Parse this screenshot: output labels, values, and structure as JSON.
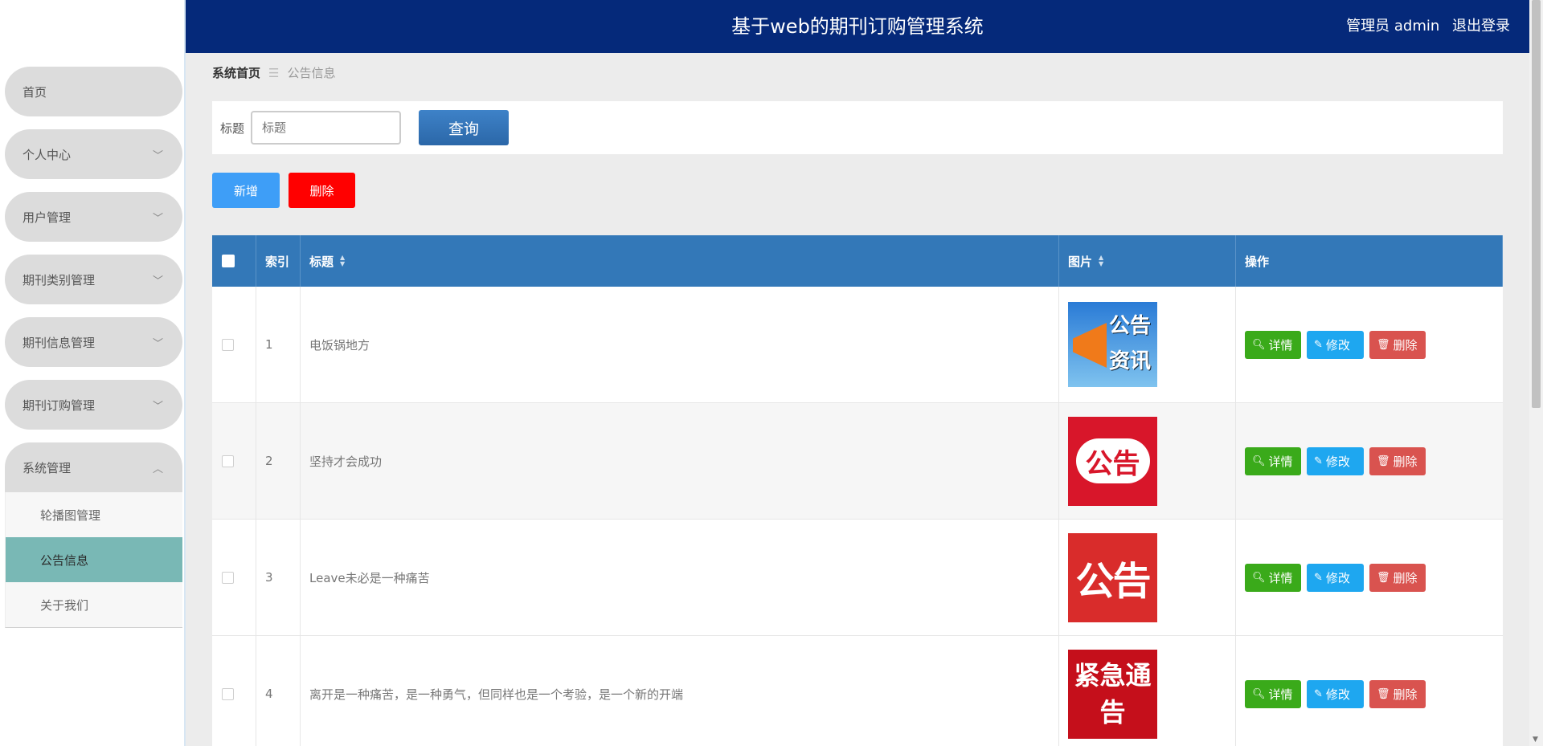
{
  "header": {
    "title": "基于web的期刊订购管理系统",
    "user_role": "管理员 admin",
    "logout": "退出登录"
  },
  "sidebar": {
    "items": [
      {
        "label": "首页"
      },
      {
        "label": "个人中心"
      },
      {
        "label": "用户管理"
      },
      {
        "label": "期刊类别管理"
      },
      {
        "label": "期刊信息管理"
      },
      {
        "label": "期刊订购管理"
      },
      {
        "label": "系统管理"
      }
    ],
    "sub_items": [
      {
        "label": "轮播图管理"
      },
      {
        "label": "公告信息"
      },
      {
        "label": "关于我们"
      }
    ]
  },
  "breadcrumb": {
    "home": "系统首页",
    "separator": "☰",
    "current": "公告信息"
  },
  "search": {
    "label": "标题",
    "placeholder": "标题",
    "button": "查询"
  },
  "actions": {
    "add": "新增",
    "delete": "删除"
  },
  "table": {
    "columns": [
      "索引",
      "标题",
      "图片",
      "操作"
    ],
    "rows": [
      {
        "index": "1",
        "title": "电饭锅地方",
        "image_text": "公告资讯"
      },
      {
        "index": "2",
        "title": "坚持才会成功",
        "image_text": "公告"
      },
      {
        "index": "3",
        "title": "Leave未必是一种痛苦",
        "image_text": "公告"
      },
      {
        "index": "4",
        "title": "离开是一种痛苦，是一种勇气，但同样也是一个考验，是一个新的开端",
        "image_text": "紧急通告"
      }
    ],
    "op_labels": {
      "detail": "详情",
      "edit": "修改",
      "delete": "删除"
    }
  }
}
